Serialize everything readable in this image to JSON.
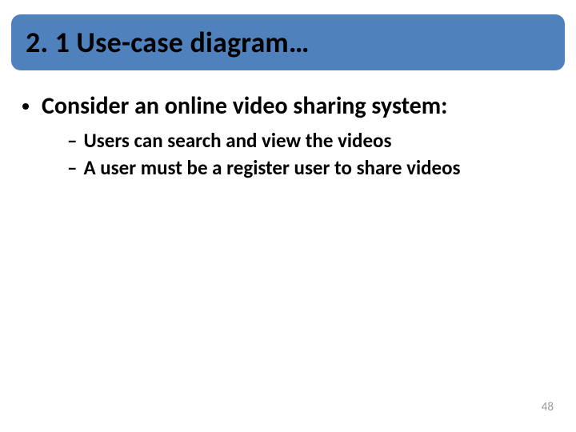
{
  "title": "2. 1 Use-case diagram…",
  "bullets": {
    "l1": "Consider an online video sharing system:",
    "l2a": "Users can search and view the videos",
    "l2b": "A user must be a register user to share videos"
  },
  "pageNumber": "48"
}
